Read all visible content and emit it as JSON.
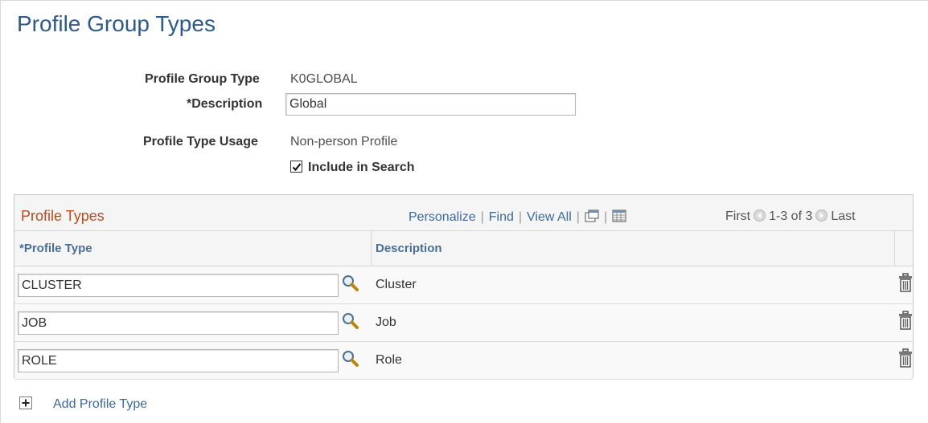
{
  "page": {
    "title": "Profile Group Types"
  },
  "form": {
    "profile_group_type_label": "Profile Group Type",
    "profile_group_type_value": "K0GLOBAL",
    "description_label": "*Description",
    "description_value": "Global",
    "usage_label": "Profile Type Usage",
    "usage_value": "Non-person Profile",
    "include_in_search_label": "Include in Search",
    "include_in_search_checked": true
  },
  "grid": {
    "title": "Profile Types",
    "nav": {
      "personalize": "Personalize",
      "find": "Find",
      "view_all": "View All",
      "sep": "|"
    },
    "pager": {
      "first": "First",
      "range": "1-3 of 3",
      "last": "Last"
    },
    "columns": {
      "profile_type": "*Profile Type",
      "description": "Description"
    },
    "rows": [
      {
        "profile_type": "CLUSTER",
        "description": "Cluster"
      },
      {
        "profile_type": "JOB",
        "description": "Job"
      },
      {
        "profile_type": "ROLE",
        "description": "Role"
      }
    ]
  },
  "actions": {
    "add_profile_type": "Add Profile Type"
  },
  "icons": {
    "lookup": "magnifier-icon",
    "delete": "trash-icon",
    "add": "plus-icon",
    "new_window": "new-window-icon",
    "download": "spreadsheet-icon",
    "prev": "arrow-left-icon",
    "next": "arrow-right-icon"
  },
  "colors": {
    "title": "#2d5a8a",
    "grid_title": "#c04a1a",
    "link": "#3a6a9e"
  }
}
